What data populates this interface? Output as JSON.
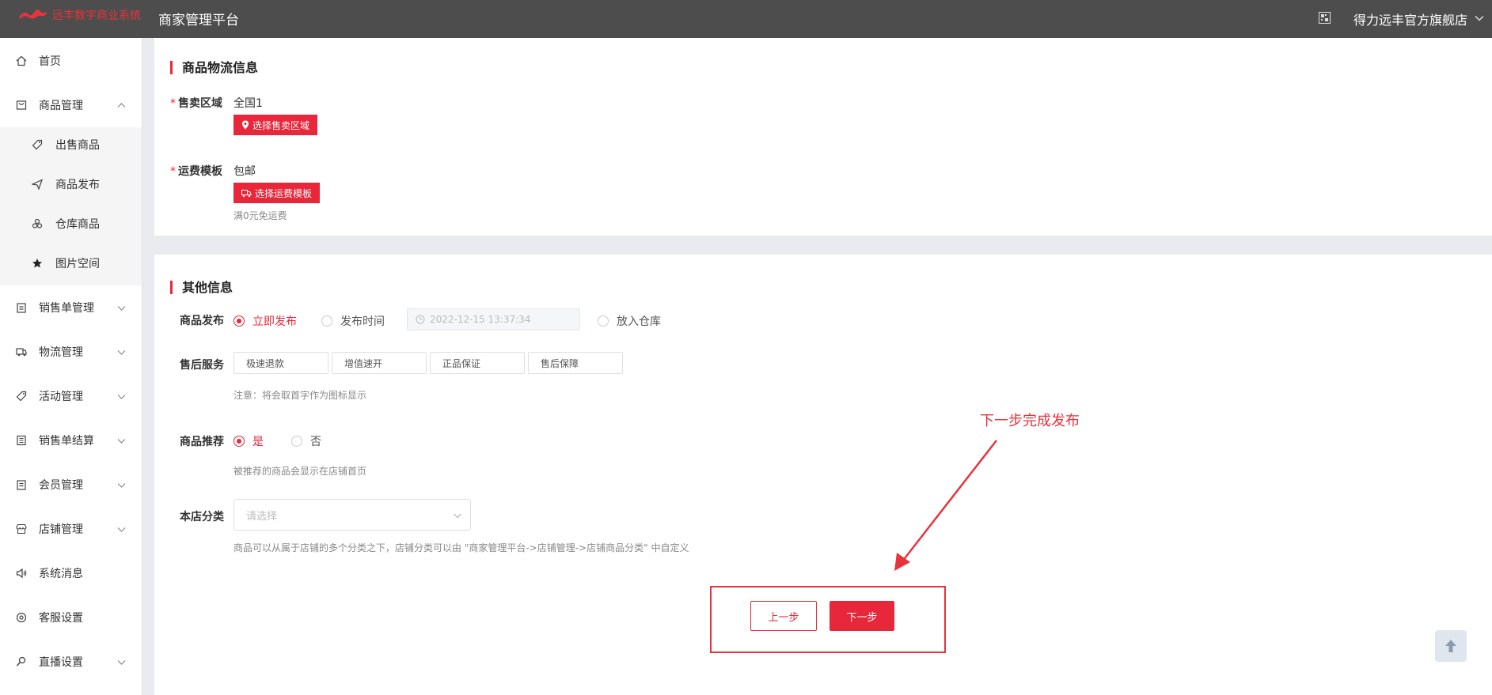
{
  "header": {
    "logo_text": "远丰数字商业系统",
    "app_title": "商家管理平台",
    "store_name": "得力远丰官方旗舰店"
  },
  "sidebar": {
    "items": [
      {
        "label": "首页",
        "icon": "home-icon"
      },
      {
        "label": "商品管理",
        "icon": "goods-icon",
        "expanded": true
      },
      {
        "label": "销售单管理",
        "icon": "clipboard-icon"
      },
      {
        "label": "物流管理",
        "icon": "truck-icon"
      },
      {
        "label": "活动管理",
        "icon": "tag-icon"
      },
      {
        "label": "销售单结算",
        "icon": "book-icon"
      },
      {
        "label": "会员管理",
        "icon": "member-icon"
      },
      {
        "label": "店铺管理",
        "icon": "store-icon"
      },
      {
        "label": "系统消息",
        "icon": "speaker-icon"
      },
      {
        "label": "客服设置",
        "icon": "service-icon"
      },
      {
        "label": "直播设置",
        "icon": "live-icon"
      }
    ],
    "sub_items": [
      {
        "label": "出售商品",
        "icon": "tag-icon"
      },
      {
        "label": "商品发布",
        "icon": "send-icon"
      },
      {
        "label": "仓库商品",
        "icon": "warehouse-icon"
      },
      {
        "label": "图片空间",
        "icon": "star-icon"
      }
    ]
  },
  "logistics": {
    "title": "商品物流信息",
    "region_label": "售卖区域",
    "region_value": "全国1",
    "region_button": "选择售卖区域",
    "freight_label": "运费模板",
    "freight_value": "包邮",
    "freight_button": "选择运费模板",
    "freight_hint": "满0元免运费"
  },
  "other": {
    "title": "其他信息",
    "publish_label": "商品发布",
    "publish_options": [
      "立即发布",
      "发布时间",
      "放入仓库"
    ],
    "publish_selected": "立即发布",
    "publish_time_placeholder": "2022-12-15 13:37:34",
    "aftersale_label": "售后服务",
    "aftersale_values": [
      "极速退款",
      "增值速开",
      "正品保证",
      "售后保障"
    ],
    "aftersale_hint": "注意：将会取首字作为图标显示",
    "recommend_label": "商品推荐",
    "recommend_options": [
      "是",
      "否"
    ],
    "recommend_selected": "是",
    "recommend_hint": "被推荐的商品会显示在店铺首页",
    "category_label": "本店分类",
    "category_placeholder": "请选择",
    "category_hint": "商品可以从属于店铺的多个分类之下，店铺分类可以由 \"商家管理平台->店铺管理->店铺商品分类\" 中自定义"
  },
  "actions": {
    "prev_label": "上一步",
    "next_label": "下一步"
  },
  "annotation": {
    "text": "下一步完成发布",
    "color": "#e8323c"
  },
  "colors": {
    "accent": "#e8273a",
    "topbar": "#4d4d4d"
  }
}
